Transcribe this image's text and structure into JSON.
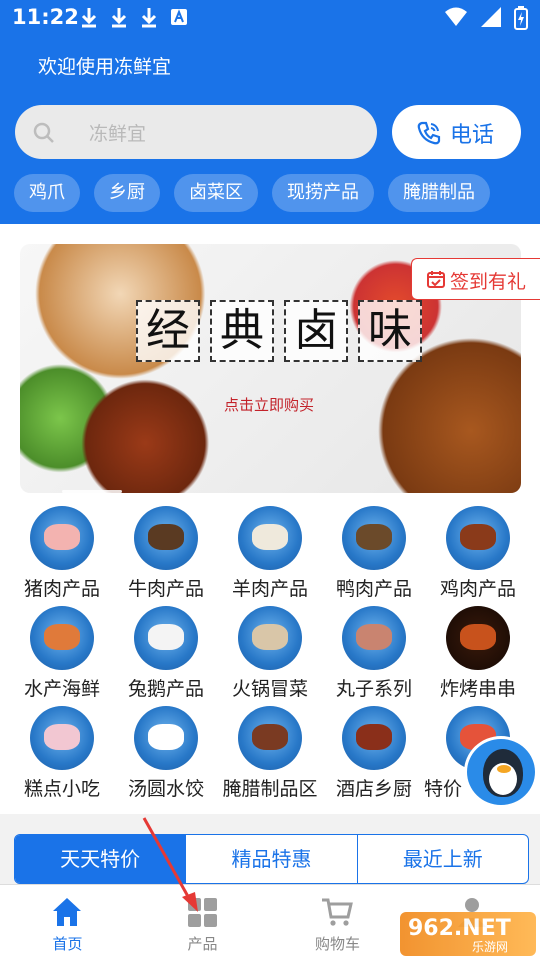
{
  "status": {
    "time": "11:22"
  },
  "header": {
    "welcome": "欢迎使用冻鲜宜",
    "search_placeholder": "冻鲜宜",
    "phone_label": "电话",
    "chips": [
      "鸡爪",
      "乡厨",
      "卤菜区",
      "现捞产品",
      "腌腊制品"
    ]
  },
  "banner": {
    "title_chars": [
      "经",
      "典",
      "卤",
      "味"
    ],
    "subtitle": "点击立即购买",
    "signin_label": "签到有礼"
  },
  "categories": [
    {
      "label": "猪肉产品",
      "icon": "pig-icon"
    },
    {
      "label": "牛肉产品",
      "icon": "cow-icon"
    },
    {
      "label": "羊肉产品",
      "icon": "sheep-icon"
    },
    {
      "label": "鸭肉产品",
      "icon": "duck-icon"
    },
    {
      "label": "鸡肉产品",
      "icon": "chicken-icon"
    },
    {
      "label": "水产海鲜",
      "icon": "seafood-icon"
    },
    {
      "label": "兔鹅产品",
      "icon": "goose-icon"
    },
    {
      "label": "火锅冒菜",
      "icon": "hotpot-icon"
    },
    {
      "label": "丸子系列",
      "icon": "meatball-icon"
    },
    {
      "label": "炸烤串串",
      "icon": "skewer-icon"
    },
    {
      "label": "糕点小吃",
      "icon": "pastry-icon"
    },
    {
      "label": "汤圆水饺",
      "icon": "dumpling-icon"
    },
    {
      "label": "腌腊制品区",
      "icon": "cured-meat-icon"
    },
    {
      "label": "酒店乡厨",
      "icon": "dish-icon"
    },
    {
      "label": "特价",
      "icon": "special-offer-icon"
    }
  ],
  "tabs": [
    "天天特价",
    "精品特惠",
    "最近上新"
  ],
  "nav": [
    {
      "label": "首页",
      "icon": "home-icon"
    },
    {
      "label": "产品",
      "icon": "grid-icon"
    },
    {
      "label": "购物车",
      "icon": "cart-icon"
    },
    {
      "label": "",
      "icon": "profile-icon"
    }
  ],
  "watermark": {
    "text": "962.NET",
    "sub": "乐游网"
  },
  "colors": {
    "primary": "#1a73e8",
    "accent_red": "#e53935",
    "chip_bg": "rgba(255,255,255,0.24)"
  }
}
